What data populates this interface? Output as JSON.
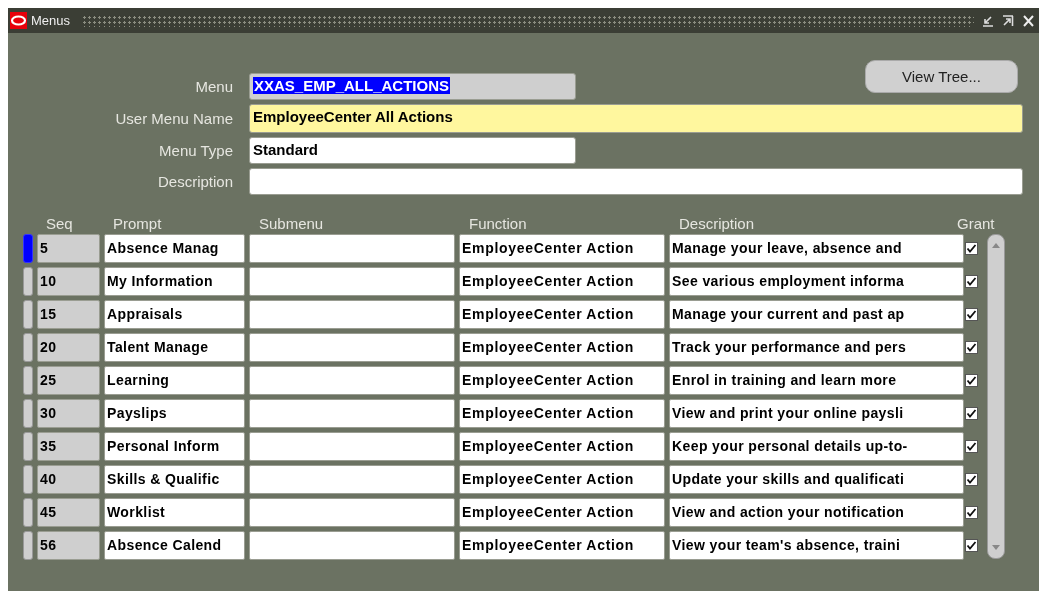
{
  "window": {
    "title": "Menus"
  },
  "header": {
    "fields": [
      {
        "label": "Menu",
        "value": "XXAS_EMP_ALL_ACTIONS",
        "kind": "selected-text",
        "wide": false
      },
      {
        "label": "User Menu Name",
        "value": "EmployeeCenter All Actions",
        "kind": "required",
        "wide": true
      },
      {
        "label": "Menu Type",
        "value": "Standard",
        "kind": "plain",
        "wide": false
      },
      {
        "label": "Description",
        "kind": "plain",
        "wide": true
      }
    ],
    "button": "View Tree..."
  },
  "table": {
    "columns": [
      "Seq",
      "Prompt",
      "Submenu",
      "Function",
      "Description",
      "Grant"
    ],
    "rows": [
      {
        "selected": true,
        "seq": "5",
        "prompt": "Absence Manag",
        "function": "EmployeeCenter Action",
        "description": "Manage your leave, absence and",
        "grant": true
      },
      {
        "selected": false,
        "seq": "10",
        "prompt": "My Information",
        "function": "EmployeeCenter Action",
        "description": "See various employment informa",
        "grant": true
      },
      {
        "selected": false,
        "seq": "15",
        "prompt": "Appraisals",
        "function": "EmployeeCenter Action",
        "description": "Manage your current and past ap",
        "grant": true
      },
      {
        "selected": false,
        "seq": "20",
        "prompt": "Talent Manage",
        "function": "EmployeeCenter Action",
        "description": "Track your performance and pers",
        "grant": true
      },
      {
        "selected": false,
        "seq": "25",
        "prompt": "Learning",
        "function": "EmployeeCenter Action",
        "description": "Enrol in training and learn more",
        "grant": true
      },
      {
        "selected": false,
        "seq": "30",
        "prompt": "Payslips",
        "function": "EmployeeCenter Action",
        "description": "View and print your online paysli",
        "grant": true
      },
      {
        "selected": false,
        "seq": "35",
        "prompt": "Personal Inform",
        "function": "EmployeeCenter Action",
        "description": "Keep your personal details up-to-",
        "grant": true
      },
      {
        "selected": false,
        "seq": "40",
        "prompt": "Skills & Qualific",
        "function": "EmployeeCenter Action",
        "description": "Update your skills and qualificati",
        "grant": true
      },
      {
        "selected": false,
        "seq": "45",
        "prompt": "Worklist",
        "function": "EmployeeCenter Action",
        "description": "View and action your notification",
        "grant": true
      },
      {
        "selected": false,
        "seq": "56",
        "prompt": "Absence Calend",
        "function": "EmployeeCenter Action",
        "description": "View your team's absence, traini",
        "grant": true
      }
    ]
  }
}
